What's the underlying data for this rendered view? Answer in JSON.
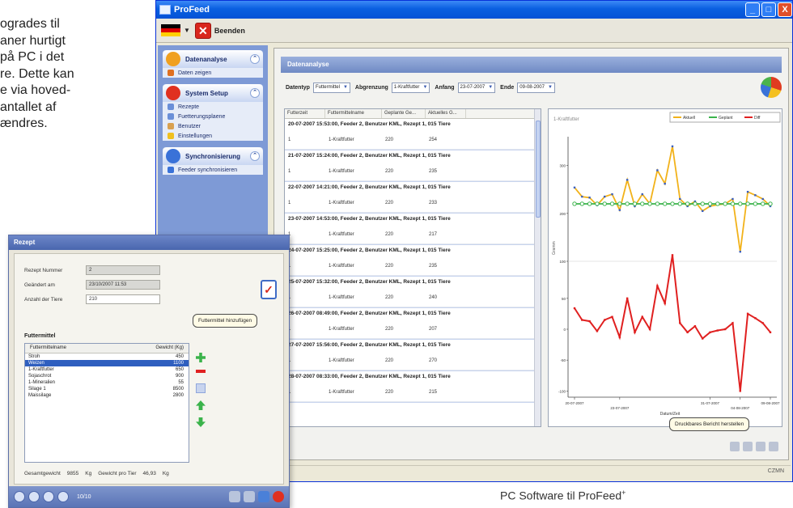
{
  "intro_lines": [
    "ogrades til",
    "aner hurtigt",
    " på PC i det",
    "re. Dette kan",
    "e via hoved-",
    " antallet af",
    "ændres."
  ],
  "caption": {
    "text": "PC Software til ProFeed",
    "sup": "+"
  },
  "window": {
    "title": "ProFeed",
    "buttons": {
      "minimize": "_",
      "maximize": "□",
      "close": "X"
    },
    "stop_label": "Beenden",
    "status_text": "CZMN"
  },
  "sidebar": {
    "groups": [
      {
        "title": "Datenanalyse",
        "color": "#f0a020",
        "items": [
          {
            "label": "Daten zeigen",
            "color": "#e07020"
          }
        ]
      },
      {
        "title": "System Setup",
        "color": "#e03020",
        "items": [
          {
            "label": "Rezepte",
            "color": "#6a8fd8"
          },
          {
            "label": "Fuetterungsplaene",
            "color": "#6a8fd8"
          },
          {
            "label": "Benutzer",
            "color": "#d8a050"
          },
          {
            "label": "Einstellungen",
            "color": "#f0c020"
          }
        ]
      },
      {
        "title": "Synchronisierung",
        "color": "#3a72d8",
        "items": [
          {
            "label": "Feeder synchronisieren",
            "color": "#3a72d8"
          }
        ]
      }
    ]
  },
  "panel": {
    "title": "Datenanalyse",
    "filters": [
      {
        "label": "Datentyp",
        "value": "Futtermittel"
      },
      {
        "label": "Abgrenzung",
        "value": "1-Kraftfutter"
      },
      {
        "label": "Anfang",
        "value": "23-07-2007"
      },
      {
        "label": "Ende",
        "value": "09-08-2007"
      }
    ]
  },
  "table": {
    "columns": [
      "Futterzeit",
      "Futtermittelname",
      "Geplante Ge...",
      "Aktuelles G..."
    ],
    "groups": [
      {
        "head": "20-07-2007 15:53:00, Feeder 2, Benutzer KML, Rezept 1, 015 Tiere",
        "row": [
          "1",
          "1-Kraftfutter",
          "220",
          "254"
        ]
      },
      {
        "head": "21-07-2007 15:24:00, Feeder 2, Benutzer KML, Rezept 1, 015 Tiere",
        "row": [
          "1",
          "1-Kraftfutter",
          "220",
          "235"
        ]
      },
      {
        "head": "22-07-2007 14:21:00, Feeder 2, Benutzer KML, Rezept 1, 015 Tiere",
        "row": [
          "1",
          "1-Kraftfutter",
          "220",
          "233"
        ]
      },
      {
        "head": "23-07-2007 14:53:00, Feeder 2, Benutzer KML, Rezept 1, 015 Tiere",
        "row": [
          "1",
          "1-Kraftfutter",
          "220",
          "217"
        ]
      },
      {
        "head": "24-07-2007 15:25:00, Feeder 2, Benutzer KML, Rezept 1, 015 Tiere",
        "row": [
          "1",
          "1-Kraftfutter",
          "220",
          "235"
        ]
      },
      {
        "head": "25-07-2007 15:32:00, Feeder 2, Benutzer KML, Rezept 1, 015 Tiere",
        "row": [
          "1",
          "1-Kraftfutter",
          "220",
          "240"
        ]
      },
      {
        "head": "26-07-2007 08:49:00, Feeder 2, Benutzer KML, Rezept 1, 015 Tiere",
        "row": [
          "1",
          "1-Kraftfutter",
          "220",
          "207"
        ]
      },
      {
        "head": "27-07-2007 15:56:00, Feeder 2, Benutzer KML, Rezept 1, 015 Tiere",
        "row": [
          "1",
          "1-Kraftfutter",
          "220",
          "270"
        ]
      },
      {
        "head": "28-07-2007 08:33:00, Feeder 2, Benutzer KML, Rezept 1, 015 Tiere",
        "row": [
          "1",
          "1-Kraftfutter",
          "220",
          "215"
        ]
      }
    ]
  },
  "chart_data": {
    "type": "line",
    "title": "1-Kraftfutter",
    "ylabel": "Gramm",
    "xlabel": "Datum/Zeit",
    "xtick_labels": [
      "20-07-2007",
      "23-07-2007",
      "31-07-2007",
      "04-08-2007",
      "09-08-2007"
    ],
    "ytick_labels": [
      "300",
      "200",
      "100",
      "50",
      "0",
      "-50",
      "-100"
    ],
    "upper_range": [
      100,
      350
    ],
    "lower_range": [
      -110,
      110
    ],
    "series": [
      {
        "name": "Aktuell",
        "color": "#f2b21a",
        "panel": "upper",
        "values": [
          254,
          235,
          233,
          217,
          235,
          240,
          207,
          270,
          215,
          240,
          220,
          290,
          262,
          340,
          230,
          215,
          225,
          205,
          215,
          218,
          220,
          230,
          120,
          245,
          238,
          230,
          215
        ]
      },
      {
        "name": "Geplant",
        "color": "#3bb34b",
        "panel": "upper",
        "values": [
          220,
          220,
          220,
          220,
          220,
          220,
          220,
          220,
          220,
          220,
          220,
          220,
          220,
          220,
          220,
          220,
          220,
          220,
          220,
          220,
          220,
          220,
          220,
          220,
          220,
          220,
          220
        ]
      },
      {
        "name": "Diff",
        "color": "#e02020",
        "panel": "lower",
        "values": [
          34,
          15,
          13,
          -3,
          15,
          20,
          -13,
          50,
          -5,
          20,
          0,
          70,
          42,
          120,
          10,
          -5,
          5,
          -15,
          -5,
          -2,
          0,
          10,
          -100,
          25,
          18,
          10,
          -5
        ]
      }
    ],
    "tooltip": "Druckbares Bericht herstellen"
  },
  "dialog": {
    "title": "Rezept",
    "fields": [
      {
        "label": "Rezept Nummer",
        "value": "2"
      },
      {
        "label": "Geändert am",
        "value": "23/10/2007 11:53"
      },
      {
        "label": "Anzahl der Tiere",
        "value": "210"
      }
    ],
    "feed_title": "Futtermittel",
    "feed_columns": [
      "Futtermittelname",
      "Gewicht (Kg)"
    ],
    "feed_items": [
      {
        "name": "Stroh",
        "weight": "450"
      },
      {
        "name": "Weizen",
        "weight": "1100"
      },
      {
        "name": "1-Kraftfutter",
        "weight": "650"
      },
      {
        "name": "Sojaschrot",
        "weight": "900"
      },
      {
        "name": "1-Mineralien",
        "weight": "55"
      },
      {
        "name": "Silage 1",
        "weight": "8500"
      },
      {
        "name": "Maissilage",
        "weight": "2800"
      }
    ],
    "selected_index": 1,
    "add_tooltip": "Futtermittel hinzufügen",
    "total_label": "Gesamtgewicht",
    "total_value": "9855",
    "total_unit": "Kg",
    "per_animal_label": "Gewicht pro Tier",
    "per_animal_value": "46,93",
    "per_animal_unit": "Kg",
    "page_text": "10/10"
  }
}
